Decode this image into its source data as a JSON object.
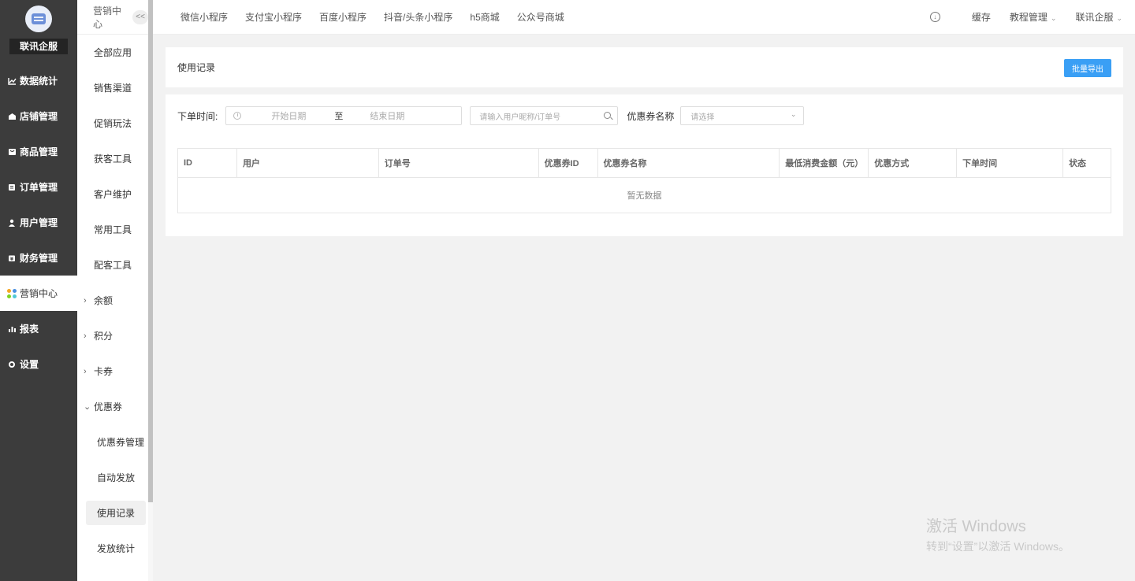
{
  "sidebar": {
    "company": "联讯企服",
    "items": [
      {
        "label": "数据统计",
        "icon": "chart-line-icon"
      },
      {
        "label": "店铺管理",
        "icon": "shop-icon"
      },
      {
        "label": "商品管理",
        "icon": "goods-icon"
      },
      {
        "label": "订单管理",
        "icon": "order-icon"
      },
      {
        "label": "用户管理",
        "icon": "user-icon"
      },
      {
        "label": "财务管理",
        "icon": "finance-icon"
      },
      {
        "label": "营销中心",
        "icon": "marketing-icon"
      },
      {
        "label": "报表",
        "icon": "bar-chart-icon"
      },
      {
        "label": "设置",
        "icon": "gear-icon"
      }
    ],
    "active": "营销中心"
  },
  "submenu": {
    "title": "营销中心",
    "collapse": "<<",
    "items": [
      "全部应用",
      "销售渠道",
      "促销玩法",
      "获客工具",
      "客户维护",
      "常用工具",
      "配客工具"
    ],
    "groups": [
      "余额",
      "积分",
      "卡券",
      "优惠券"
    ],
    "coupon_children": [
      "优惠券管理",
      "自动发放",
      "使用记录",
      "发放统计"
    ],
    "active": "使用记录"
  },
  "topbar": {
    "links": [
      "微信小程序",
      "支付宝小程序",
      "百度小程序",
      "抖音/头条小程序",
      "h5商城",
      "公众号商城"
    ],
    "cache": "缓存",
    "tutorial": "教程管理",
    "account": "联讯企服"
  },
  "page": {
    "title": "使用记录",
    "export_button": "批量导出"
  },
  "filters": {
    "order_time_label": "下单时间:",
    "start_placeholder": "开始日期",
    "range_separator": "至",
    "end_placeholder": "结束日期",
    "search_placeholder": "请输入用户昵称/订单号",
    "coupon_name_label": "优惠券名称",
    "coupon_select_placeholder": "请选择"
  },
  "table": {
    "columns": [
      "ID",
      "用户",
      "订单号",
      "优惠券ID",
      "优惠券名称",
      "最低消费金额（元）",
      "优惠方式",
      "下单时间",
      "状态"
    ],
    "empty_text": "暂无数据"
  },
  "watermark": {
    "line1": "激活 Windows",
    "line2": "转到“设置”以激活 Windows。"
  },
  "colors": {
    "sidebar_bg": "#3c3c3c",
    "primary": "#3a9ff5",
    "page_bg": "#f2f2f2"
  }
}
